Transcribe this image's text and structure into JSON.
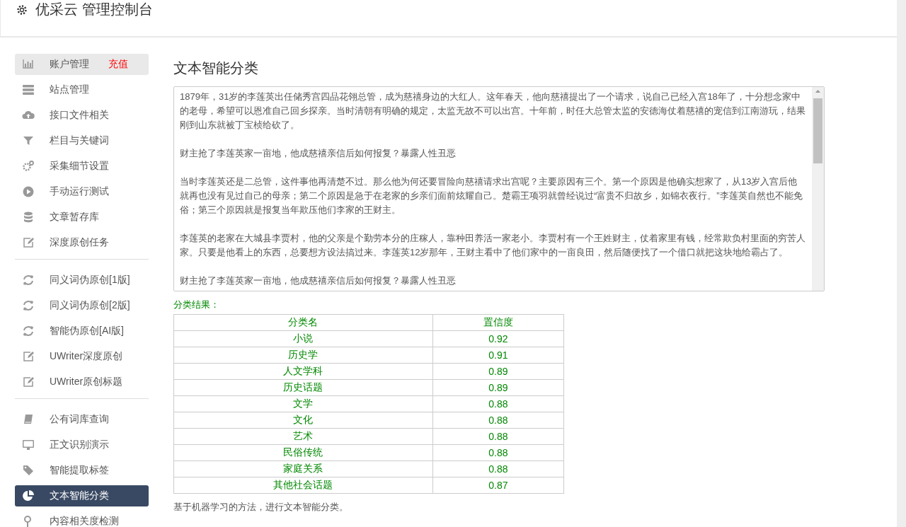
{
  "header": {
    "title": "优采云 管理控制台"
  },
  "sidebar": {
    "groups": [
      [
        {
          "label": "账户管理",
          "link": "充值",
          "selected": false,
          "hovered": true
        },
        {
          "label": "站点管理",
          "selected": false,
          "hovered": false
        },
        {
          "label": "接口文件相关",
          "selected": false,
          "hovered": false
        },
        {
          "label": "栏目与关键词",
          "selected": false,
          "hovered": false
        },
        {
          "label": "采集细节设置",
          "selected": false,
          "hovered": false
        },
        {
          "label": "手动运行测试",
          "selected": false,
          "hovered": false
        },
        {
          "label": "文章暂存库",
          "selected": false,
          "hovered": false
        },
        {
          "label": "深度原创任务",
          "selected": false,
          "hovered": false
        }
      ],
      [
        {
          "label": "同义词伪原创[1版]",
          "selected": false,
          "hovered": false
        },
        {
          "label": "同义词伪原创[2版]",
          "selected": false,
          "hovered": false
        },
        {
          "label": "智能伪原创[AI版]",
          "selected": false,
          "hovered": false
        },
        {
          "label": "UWriter深度原创",
          "selected": false,
          "hovered": false
        },
        {
          "label": "UWriter原创标题",
          "selected": false,
          "hovered": false
        }
      ],
      [
        {
          "label": "公有词库查询",
          "selected": false,
          "hovered": false
        },
        {
          "label": "正文识别演示",
          "selected": false,
          "hovered": false
        },
        {
          "label": "智能提取标签",
          "selected": false,
          "hovered": false
        },
        {
          "label": "文本智能分类",
          "selected": true,
          "hovered": false
        },
        {
          "label": "内容相关度检测",
          "selected": false,
          "hovered": false
        }
      ]
    ]
  },
  "main": {
    "title": "文本智能分类",
    "text_paragraphs": [
      "1879年，31岁的李莲英出任储秀宫四品花翎总管，成为慈禧身边的大红人。这年春天，他向慈禧提出了一个请求，说自己已经入宫18年了，十分想念家中的老母，希望可以恩准自己回乡探亲。当时清朝有明确的规定，太监无故不可以出宫。十年前，时任大总管太监的安德海仗着慈禧的宠信到江南游玩，结果刚到山东就被丁宝桢给砍了。",
      "财主抢了李莲英家一亩地，他成慈禧亲信后如何报复？暴露人性丑恶",
      "当时李莲英还是二总管，这件事他再清楚不过。那么他为何还要冒险向慈禧请求出宫呢？主要原因有三个。第一个原因是他确实想家了，从13岁入宫后他就再也没有见过自己的母亲；第二个原因是急于在老家的乡亲们面前炫耀自己。楚霸王项羽就曾经说过“富贵不归故乡，如锦衣夜行。”李莲英自然也不能免俗；第三个原因就是报复当年欺压他们李家的王财主。",
      "李莲英的老家在大城县李贾村，他的父亲是个勤劳本分的庄稼人，靠种田养活一家老小。李贾村有一个王姓财主，仗着家里有钱，经常欺负村里面的穷苦人家。只要是他看上的东西，总要想方设法搞过来。李莲英12岁那年，王财主看中了他们家中的一亩良田，然后随便找了一个借口就把这块地给霸占了。",
      "财主抢了李莲英家一亩地，他成慈禧亲信后如何报复？暴露人性丑恶"
    ],
    "result_label": "分类结果：",
    "table": {
      "columns": [
        "分类名",
        "置信度"
      ],
      "rows": [
        [
          "小说",
          "0.92"
        ],
        [
          "历史学",
          "0.91"
        ],
        [
          "人文学科",
          "0.89"
        ],
        [
          "历史话题",
          "0.89"
        ],
        [
          "文学",
          "0.88"
        ],
        [
          "文化",
          "0.88"
        ],
        [
          "艺术",
          "0.88"
        ],
        [
          "民俗传统",
          "0.88"
        ],
        [
          "家庭关系",
          "0.88"
        ],
        [
          "其他社会话题",
          "0.87"
        ]
      ]
    },
    "note": "基于机器学习的方法，进行文本智能分类。"
  }
}
